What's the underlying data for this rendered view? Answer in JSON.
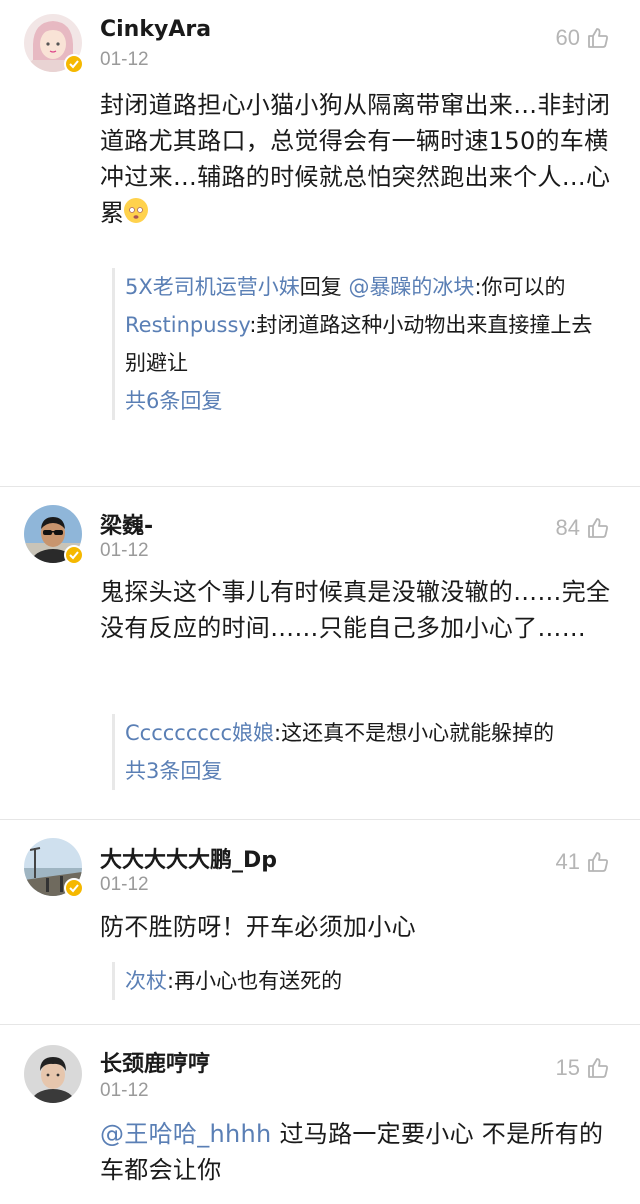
{
  "comments": [
    {
      "username": "CinkyAra",
      "date": "01-12",
      "likes": "60",
      "verified": true,
      "avatar_icon": "girl-avatar",
      "body": "封闭道路担心小猫小狗从隔离带窜出来…非封闭道路尤其路口，总觉得会有一辆时速150的车横冲过来…辅路的时候就总怕突然跑出来个人…心累",
      "emoji": "dizzy-face-emoji",
      "replies": [
        {
          "name": "5X老司机运营小妹",
          "mid": "回复 ",
          "mention": "@暴躁的冰块",
          "text": ":你可以的"
        },
        {
          "name": "Restinpussy",
          "text": ":封闭道路这种小动物出来直接撞上去 别避让"
        }
      ],
      "reply_total": "共6条回复"
    },
    {
      "username": "梁巍-",
      "date": "01-12",
      "likes": "84",
      "verified": true,
      "avatar_icon": "sunglasses-man-avatar",
      "body": "鬼探头这个事儿有时候真是没辙没辙的……完全没有反应的时间……只能自己多加小心了……",
      "replies": [
        {
          "name": "Ccccccccc娘娘",
          "text": ":这还真不是想小心就能躲掉的"
        }
      ],
      "reply_total": "共3条回复"
    },
    {
      "username": "大大大大大鹏_Dp",
      "date": "01-12",
      "likes": "41",
      "verified": true,
      "avatar_icon": "pier-landscape-avatar",
      "body": "防不胜防呀！开车必须加小心",
      "replies": [
        {
          "name": "次杖",
          "text": ":再小心也有送死的"
        }
      ]
    },
    {
      "username": "长颈鹿哼哼",
      "date": "01-12",
      "likes": "15",
      "verified": false,
      "avatar_icon": "boy-avatar",
      "mention": "@王哈哈_hhhh",
      "body": " 过马路一定要小心 不是所有的车都会让你"
    }
  ],
  "colors": {
    "link": "#5a7fb5",
    "badge": "#f5b800",
    "muted": "#9a9a9a"
  }
}
